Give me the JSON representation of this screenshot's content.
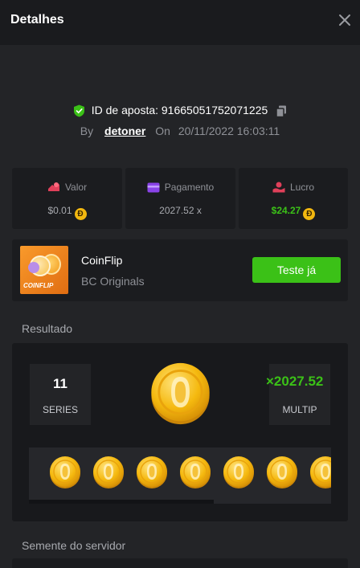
{
  "header": {
    "title": "Detalhes"
  },
  "bet": {
    "id_label": "ID de aposta: 91665051752071225",
    "by_label": "By",
    "user": "detoner",
    "on_label": "On",
    "datetime": "20/11/2022 16:03:11"
  },
  "stats": [
    {
      "label": "Valor",
      "value": "$0.01",
      "coin": "Ð"
    },
    {
      "label": "Pagamento",
      "value": "2027.52 x"
    },
    {
      "label": "Lucro",
      "value": "$24.27",
      "coin": "Ð"
    }
  ],
  "game": {
    "name": "CoinFlip",
    "provider": "BC Originals",
    "thumb_text": "COINFLIP",
    "try_button": "Teste já"
  },
  "result": {
    "section_title": "Resultado",
    "series_value": "11",
    "series_label": "SERIES",
    "multiplier": "×2027.52",
    "multiplier_label": "MULTIP",
    "coins_shown": 7
  },
  "server_seed": {
    "section_title": "Semente do servidor"
  },
  "colors": {
    "accent_green": "#3bc117",
    "panel": "#1b1c1f",
    "background": "#232427",
    "coin_gold": "#f2b70f"
  },
  "icons": {
    "close": "close-icon",
    "shield": "shield-check-icon",
    "copy": "copy-icon",
    "valor": "coins-icon",
    "pagamento": "wallet-icon",
    "lucro": "profit-hand-icon"
  }
}
